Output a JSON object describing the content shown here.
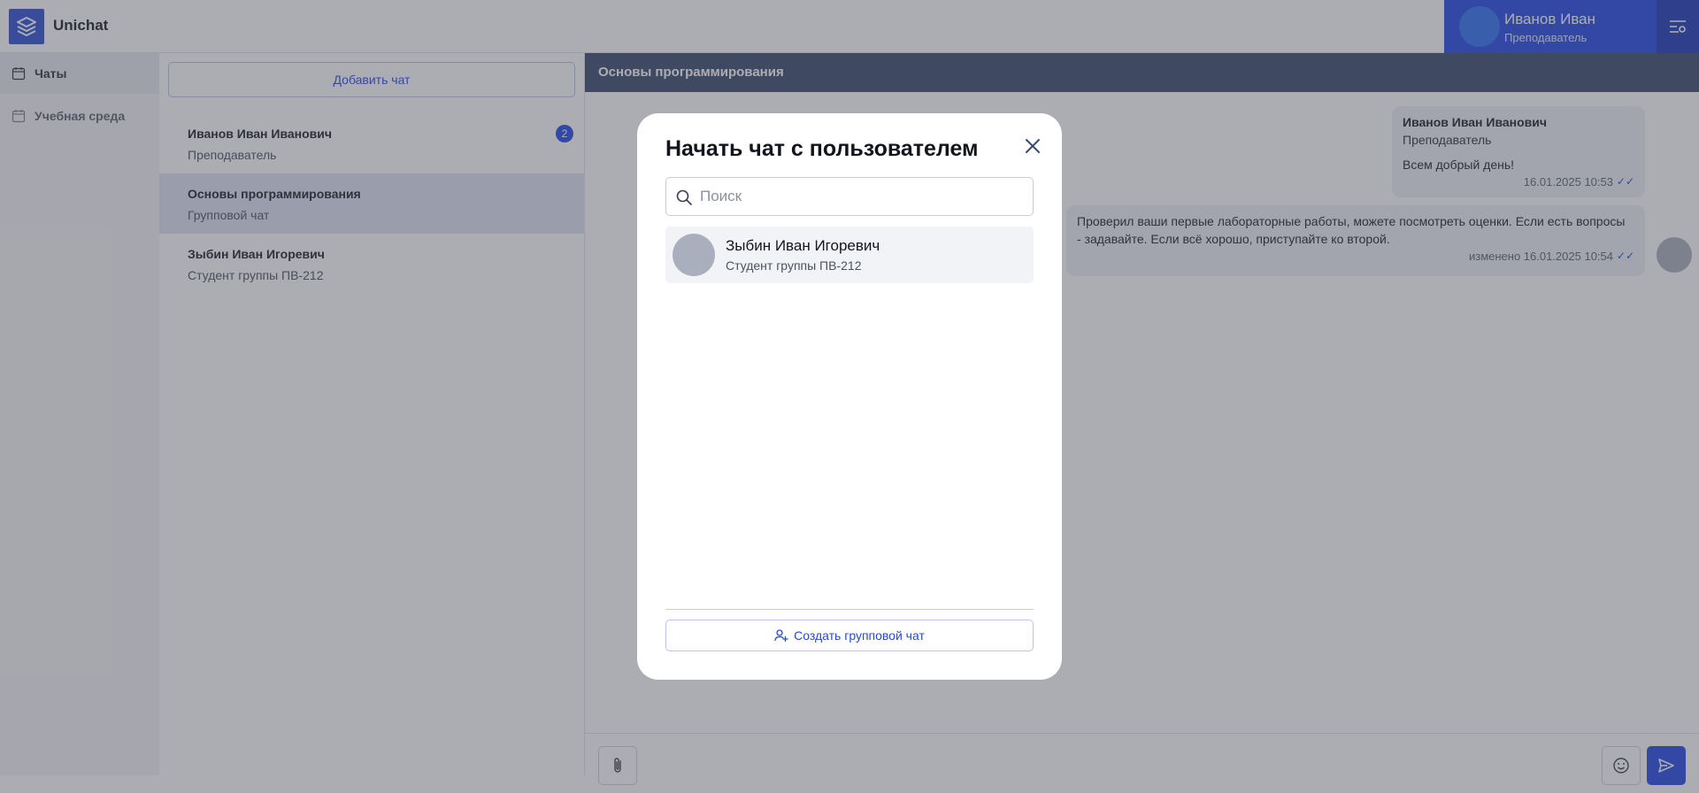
{
  "app": {
    "title": "Unichat"
  },
  "user": {
    "name": "Иванов Иван",
    "role": "Преподаватель"
  },
  "nav": {
    "items": [
      {
        "label": "Чаты",
        "icon": "calendar-icon",
        "active": true
      },
      {
        "label": "Учебная среда",
        "icon": "calendar-icon",
        "active": false
      }
    ]
  },
  "chat_list": {
    "add_button": "Добавить чат",
    "items": [
      {
        "name": "Иванов Иван Иванович",
        "subtitle": "Преподаватель",
        "unread": "2"
      },
      {
        "name": "Основы программирования",
        "subtitle": "Групповой чат"
      },
      {
        "name": "Зыбин Иван Игоревич",
        "subtitle": "Студент группы ПВ-212"
      }
    ]
  },
  "chat": {
    "title": "Основы программирования",
    "messages": [
      {
        "author": "Иванов Иван Иванович",
        "role": "Преподаватель",
        "text": "Всем добрый день!",
        "time": "16.01.2025 10:53"
      },
      {
        "text": "Проверил ваши первые лабораторные работы, можете посмотреть оценки. Если есть вопросы - задавайте. Если всё хорошо, приступайте ко второй.",
        "time": "изменено 16.01.2025 10:54"
      }
    ]
  },
  "modal": {
    "title": "Начать чат с пользователем",
    "search_placeholder": "Поиск",
    "users": [
      {
        "name": "Зыбин Иван Игоревич",
        "subtitle": "Студент группы ПВ-212"
      }
    ],
    "group_button": "Создать групповой чат"
  },
  "colors": {
    "accent": "#2448e8",
    "header": "#3a4c6e"
  }
}
